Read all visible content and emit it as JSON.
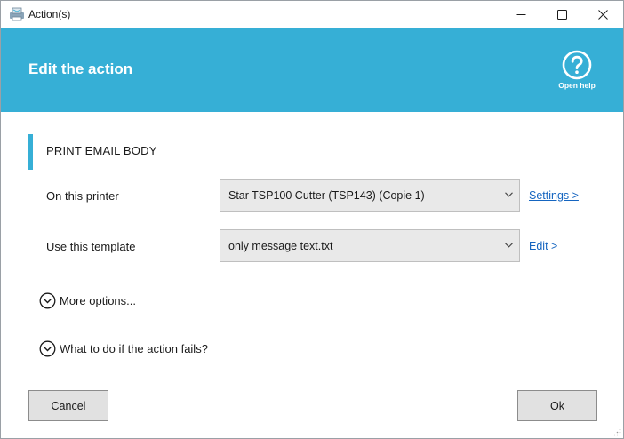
{
  "window": {
    "title": "Action(s)",
    "controls": {
      "minimize_icon": "minimize-icon",
      "maximize_icon": "maximize-icon",
      "close_icon": "close-icon"
    }
  },
  "header": {
    "title": "Edit the action",
    "help_label": "Open help",
    "background_color": "#36afd6"
  },
  "section": {
    "title": "PRINT EMAIL BODY",
    "accent_color": "#36afd6"
  },
  "rows": {
    "printer": {
      "label": "On this printer",
      "selected": "Star TSP100 Cutter (TSP143) (Copie 1)",
      "link": "Settings >"
    },
    "template": {
      "label": "Use this template",
      "selected": "only message text.txt",
      "link": "Edit >"
    }
  },
  "expanders": {
    "more_options": "More options...",
    "on_failure": "What to do if the action fails?"
  },
  "buttons": {
    "cancel": "Cancel",
    "ok": "Ok"
  },
  "colors": {
    "link": "#1565c0",
    "button_face": "#e1e1e1",
    "select_face": "#e9e9e9"
  }
}
